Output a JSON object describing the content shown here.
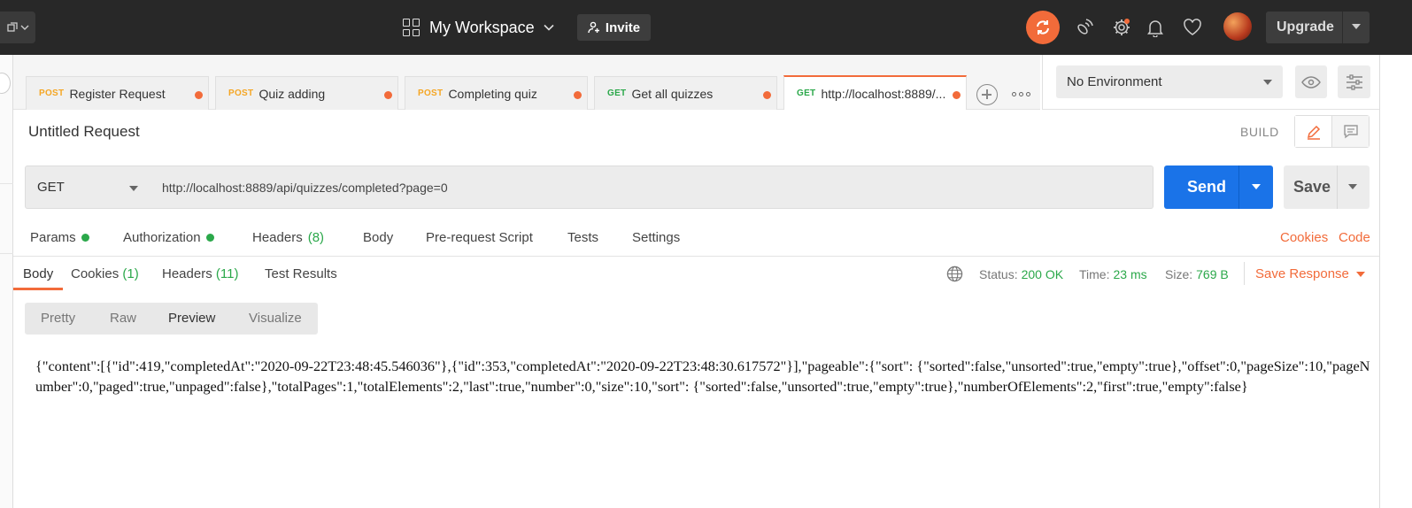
{
  "topbar": {
    "workspace_name": "My Workspace",
    "invite_label": "Invite",
    "upgrade_label": "Upgrade",
    "icons": [
      "new-window-icon",
      "workspace-grid-icon",
      "sync-icon",
      "satellite-icon",
      "settings-icon",
      "notification-bell-icon",
      "heart-icon",
      "avatar"
    ],
    "accent_color": "#f26b3a"
  },
  "tabs": [
    {
      "method": "POST",
      "label": "Register Request",
      "unsaved": true
    },
    {
      "method": "POST",
      "label": "Quiz adding",
      "unsaved": true
    },
    {
      "method": "POST",
      "label": "Completing quiz",
      "unsaved": true
    },
    {
      "method": "GET",
      "label": "Get all quizzes",
      "unsaved": true
    },
    {
      "method": "GET",
      "label": "http://localhost:8889/...",
      "unsaved": true,
      "active": true
    }
  ],
  "environment": {
    "selected": "No Environment"
  },
  "request": {
    "title": "Untitled Request",
    "build_label": "BUILD",
    "method": "GET",
    "url": "http://localhost:8889/api/quizzes/completed?page=0",
    "send_label": "Send",
    "save_label": "Save",
    "tabs": {
      "params": "Params",
      "authorization": "Authorization",
      "headers": "Headers",
      "headers_count": "(8)",
      "body": "Body",
      "prerequest": "Pre-request Script",
      "tests": "Tests",
      "settings": "Settings"
    },
    "cookies_link": "Cookies",
    "code_link": "Code"
  },
  "response": {
    "tabs": {
      "body": "Body",
      "cookies": "Cookies",
      "cookies_count": "(1)",
      "headers": "Headers",
      "headers_count": "(11)",
      "test_results": "Test Results"
    },
    "status_label": "Status:",
    "status_value": "200 OK",
    "time_label": "Time:",
    "time_value": "23 ms",
    "size_label": "Size:",
    "size_value": "769 B",
    "save_response_label": "Save Response",
    "view_modes": [
      "Pretty",
      "Raw",
      "Preview",
      "Visualize"
    ],
    "active_view": "Preview",
    "body_text": "{\"content\":[{\"id\":419,\"completedAt\":\"2020-09-22T23:48:45.546036\"},{\"id\":353,\"completedAt\":\"2020-09-22T23:48:30.617572\"}],\"pageable\":{\"sort\": {\"sorted\":false,\"unsorted\":true,\"empty\":true},\"offset\":0,\"pageSize\":10,\"pageNumber\":0,\"paged\":true,\"unpaged\":false},\"totalPages\":1,\"totalElements\":2,\"last\":true,\"number\":0,\"size\":10,\"sort\": {\"sorted\":false,\"unsorted\":true,\"empty\":true},\"numberOfElements\":2,\"first\":true,\"empty\":false}"
  }
}
